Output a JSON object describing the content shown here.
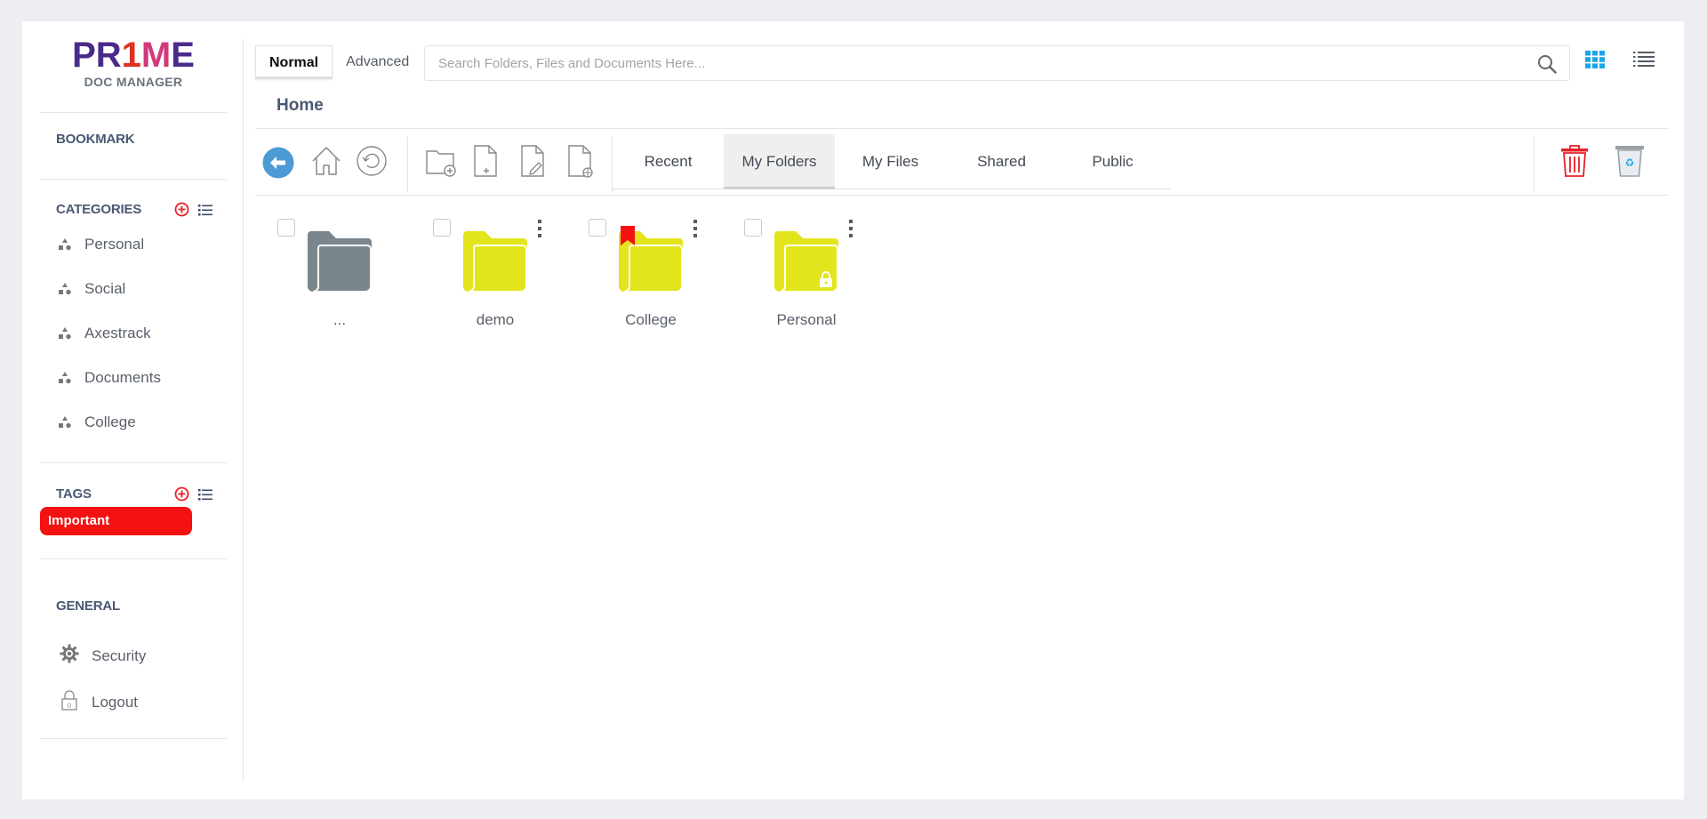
{
  "logo": {
    "mark": "PR1ME",
    "sub": "DOC MANAGER"
  },
  "sidebar": {
    "bookmark_title": "BOOKMARK",
    "categories_title": "CATEGORIES",
    "categories": [
      {
        "label": "Personal"
      },
      {
        "label": "Social"
      },
      {
        "label": "Axestrack"
      },
      {
        "label": "Documents"
      },
      {
        "label": "College"
      }
    ],
    "tags_title": "TAGS",
    "tags": [
      {
        "label": "Important",
        "color": "#f31111"
      }
    ],
    "general_title": "GENERAL",
    "general": [
      {
        "label": "Security",
        "icon": "gear-icon"
      },
      {
        "label": "Logout",
        "icon": "lock-icon"
      }
    ]
  },
  "topbar": {
    "modes": [
      "Normal",
      "Advanced"
    ],
    "active_mode": "Normal",
    "search_placeholder": "Search Folders, Files and Documents Here...",
    "search_value": ""
  },
  "breadcrumb": "Home",
  "nav_tabs": [
    "Recent",
    "My Folders",
    "My Files",
    "Shared",
    "Public"
  ],
  "active_nav_tab": "My Folders",
  "items": [
    {
      "label": "...",
      "color": "#7b858c",
      "type": "parent"
    },
    {
      "label": "demo",
      "color": "#e2e51b",
      "type": "folder"
    },
    {
      "label": "College",
      "color": "#e2e51b",
      "type": "folder",
      "bookmarked": true
    },
    {
      "label": "Personal",
      "color": "#e2e51b",
      "type": "folder",
      "locked": true
    }
  ],
  "colors": {
    "accent": "#1aa6e6",
    "danger": "#f31111",
    "folder": "#e2e51b",
    "nav_text": "#4a5872"
  }
}
